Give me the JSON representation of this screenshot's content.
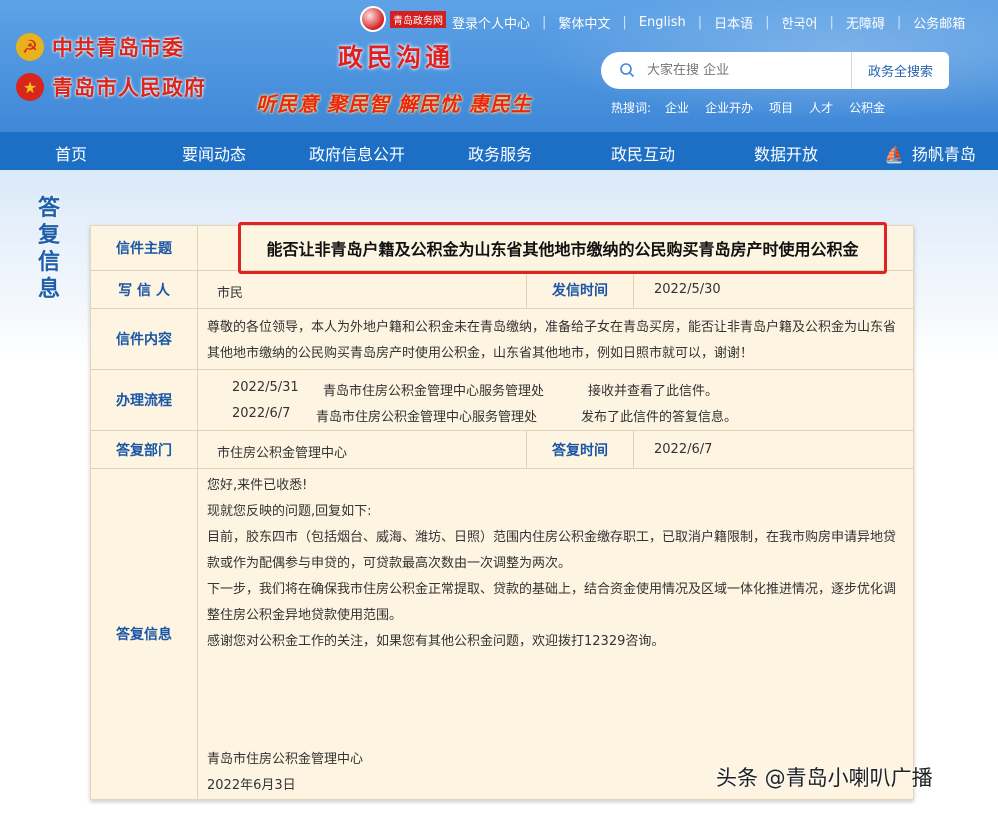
{
  "header": {
    "party_committee": "中共青岛市委",
    "government": "青岛市人民政府",
    "portal_badge": "青岛政务网",
    "portal_title": "政民沟通",
    "slogan": "听民意 聚民智 解民忧 惠民生",
    "top_links": [
      "登录个人中心",
      "繁体中文",
      "English",
      "日本语",
      "한국어",
      "无障碍",
      "公务邮箱"
    ],
    "search": {
      "placeholder": "大家在搜 企业",
      "button": "政务全搜索"
    },
    "hot_label": "热搜词:",
    "hot_words": [
      "企业",
      "企业开办",
      "项目",
      "人才",
      "公积金"
    ]
  },
  "nav": {
    "items": [
      "首页",
      "要闻动态",
      "政府信息公开",
      "政务服务",
      "政民互动",
      "数据开放",
      "扬帆青岛"
    ]
  },
  "side_label": "答复信息",
  "letter": {
    "subject_label": "信件主题",
    "subject": "能否让非青岛户籍及公积金为山东省其他地市缴纳的公民购买青岛房产时使用公积金",
    "writer_label": "写 信 人",
    "writer": "市民",
    "sent_label": "发信时间",
    "sent_date": "2022/5/30",
    "content_label": "信件内容",
    "content": "尊敬的各位领导，本人为外地户籍和公积金未在青岛缴纳，准备给子女在青岛买房，能否让非青岛户籍及公积金为山东省其他地市缴纳的公民购买青岛房产时使用公积金，山东省其他地市，例如日照市就可以，谢谢！",
    "flow_label": "办理流程",
    "flow": [
      {
        "date": "2022/5/31",
        "dept": "青岛市住房公积金管理中心服务管理处",
        "action": "接收并查看了此信件。"
      },
      {
        "date": "2022/6/7",
        "dept": "青岛市住房公积金管理中心服务管理处",
        "action": "发布了此信件的答复信息。"
      }
    ],
    "reply_dept_label": "答复部门",
    "reply_dept": "市住房公积金管理中心",
    "reply_time_label": "答复时间",
    "reply_date": "2022/6/7",
    "reply_label": "答复信息",
    "reply_lines": [
      "您好,来件已收悉!",
      "现就您反映的问题,回复如下:",
      "目前，胶东四市（包括烟台、威海、潍坊、日照）范围内住房公积金缴存职工，已取消户籍限制，在我市购房申请异地贷款或作为配偶参与申贷的，可贷款最高次数由一次调整为两次。",
      "下一步，我们将在确保我市住房公积金正常提取、贷款的基础上，结合资金使用情况及区域一体化推进情况，逐步优化调整住房公积金异地贷款使用范围。",
      "感谢您对公积金工作的关注，如果您有其他公积金问题，欢迎拨打12329咨询。"
    ],
    "reply_signature": "青岛市住房公积金管理中心",
    "reply_sign_date": "2022年6月3日"
  },
  "watermark": "头条 @青岛小喇叭广播"
}
